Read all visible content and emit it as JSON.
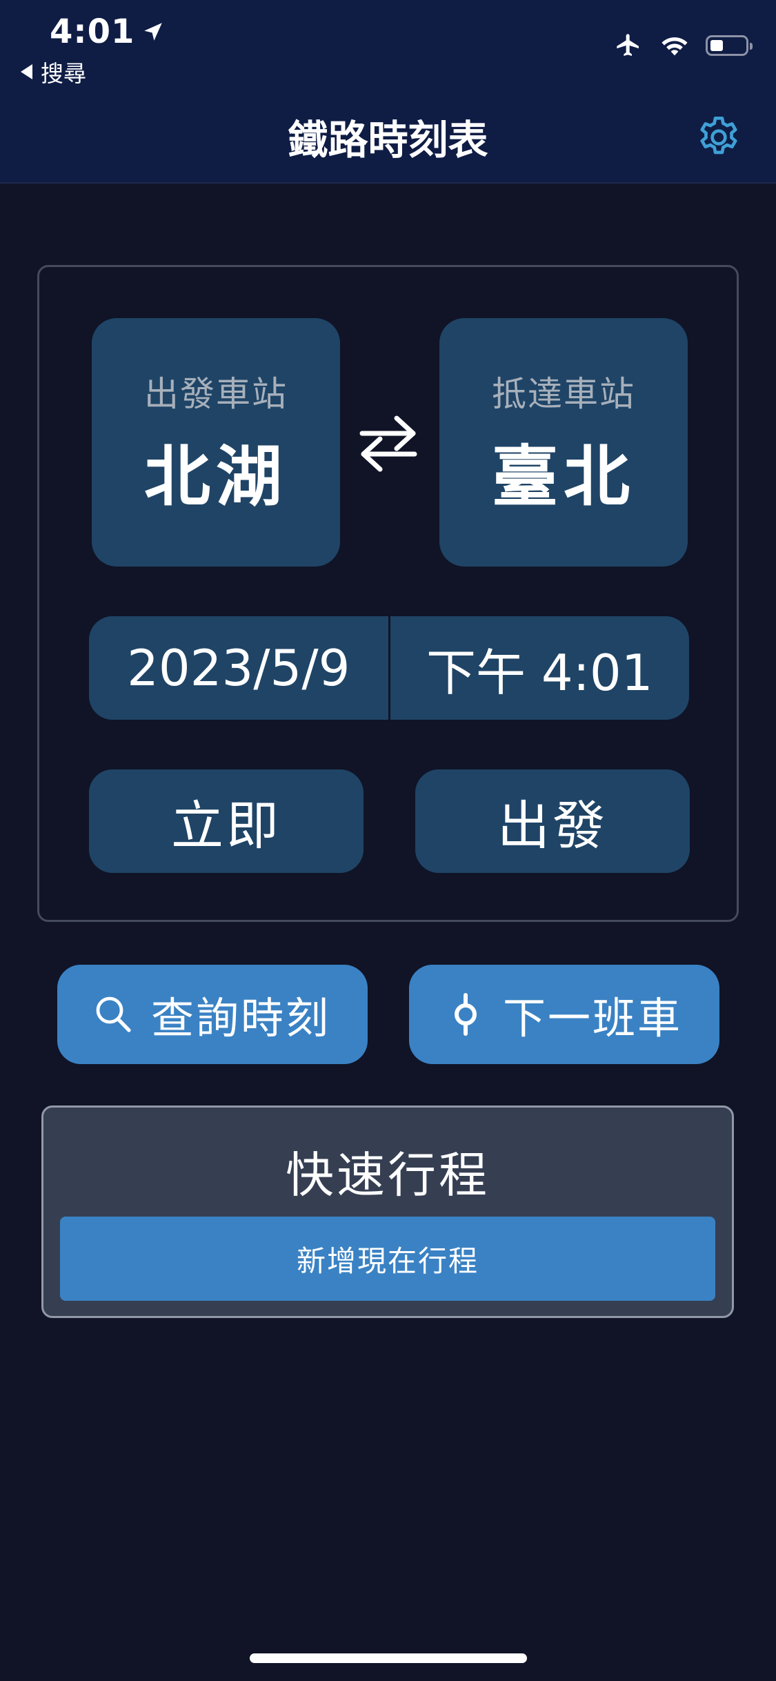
{
  "status_bar": {
    "time": "4:01",
    "back_app": "搜尋",
    "icons": [
      "location-arrow-icon",
      "airplane-icon",
      "wifi-icon",
      "battery-icon"
    ]
  },
  "nav": {
    "title": "鐵路時刻表",
    "settings_icon": "gear-icon"
  },
  "trip": {
    "from_label": "出發車站",
    "from_station": "北湖",
    "to_label": "抵達車站",
    "to_station": "臺北",
    "swap_icon": "swap-arrows-icon",
    "date": "2023/5/9",
    "time": "下午 4:01",
    "mode_now": "立即",
    "mode_depart": "出發"
  },
  "actions": {
    "search_label": "查詢時刻",
    "search_icon": "search-icon",
    "next_label": "下一班車",
    "next_icon": "station-pin-icon"
  },
  "quick_trips": {
    "title": "快速行程",
    "add_label": "新增現在行程"
  },
  "colors": {
    "background": "#101426",
    "header": "#0f1d45",
    "tile": "#1f4466",
    "accent": "#3a82c4",
    "panel": "#363f52",
    "gear": "#3fa0d6"
  }
}
